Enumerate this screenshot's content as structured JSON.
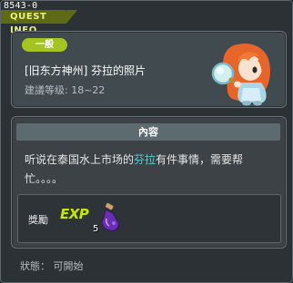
{
  "window": {
    "quest_id": "8543-0",
    "title": "QUEST INFO"
  },
  "header": {
    "category": "一般",
    "quest_title": "[旧东方神州] 芬拉的照片",
    "level_prefix": "建議等级:",
    "level_range": "18~22"
  },
  "content": {
    "header": "內容",
    "text_before": "听说在泰国水上市场的",
    "text_highlight": "芬拉",
    "text_after": "有件事情，需要帮忙。。。。"
  },
  "reward": {
    "label": "獎勵",
    "exp_label": "EXP",
    "item_count": "5"
  },
  "status": {
    "text": "狀態： 可開始"
  },
  "colors": {
    "accent_green": "#a4c421",
    "highlight_cyan": "#53d2d2",
    "exp_yellow": "#c8e21a",
    "title_tab": "#5e6a15"
  },
  "icons": {
    "npc": "npc-girl-with-magnifier-icon",
    "exp": "exp-icon",
    "potion": "purple-potion-icon"
  }
}
